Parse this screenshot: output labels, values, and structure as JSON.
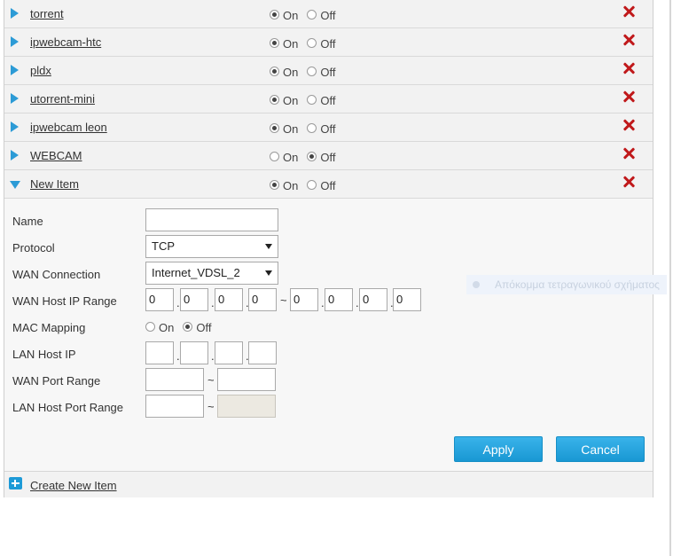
{
  "items": [
    {
      "name": "torrent",
      "state": "on"
    },
    {
      "name": "ipwebcam-htc",
      "state": "on"
    },
    {
      "name": "pldx",
      "state": "on"
    },
    {
      "name": "utorrent-mini",
      "state": "on"
    },
    {
      "name": "ipwebcam leon",
      "state": "on"
    },
    {
      "name": "WEBCAM",
      "state": "off"
    },
    {
      "name": "New Item",
      "state": "on",
      "expanded": true
    }
  ],
  "radio_labels": {
    "on": "On",
    "off": "Off"
  },
  "form": {
    "name_label": "Name",
    "name_value": "",
    "protocol_label": "Protocol",
    "protocol_value": "TCP",
    "wan_connection_label": "WAN Connection",
    "wan_connection_value": "Internet_VDSL_2",
    "wan_host_ip_range_label": "WAN Host IP Range",
    "wan_host_ip_start": [
      "0",
      "0",
      "0",
      "0"
    ],
    "wan_host_ip_end": [
      "0",
      "0",
      "0",
      "0"
    ],
    "range_sep": "~",
    "dot_sep": ".",
    "mac_mapping_label": "MAC Mapping",
    "mac_mapping_state": "off",
    "lan_host_ip_label": "LAN Host IP",
    "lan_host_ip": [
      "",
      "",
      "",
      ""
    ],
    "wan_port_range_label": "WAN Port Range",
    "wan_port_start": "",
    "wan_port_end": "",
    "lan_host_port_range_label": "LAN Host Port Range",
    "lan_port_start": "",
    "lan_port_end": "",
    "apply_label": "Apply",
    "cancel_label": "Cancel"
  },
  "footer": {
    "create_label": "Create New Item"
  },
  "overlay_text": "Απόκομμα τετραγωνικού σχήματος",
  "colors": {
    "accent": "#1d9ad7",
    "delete": "#c0191b"
  }
}
